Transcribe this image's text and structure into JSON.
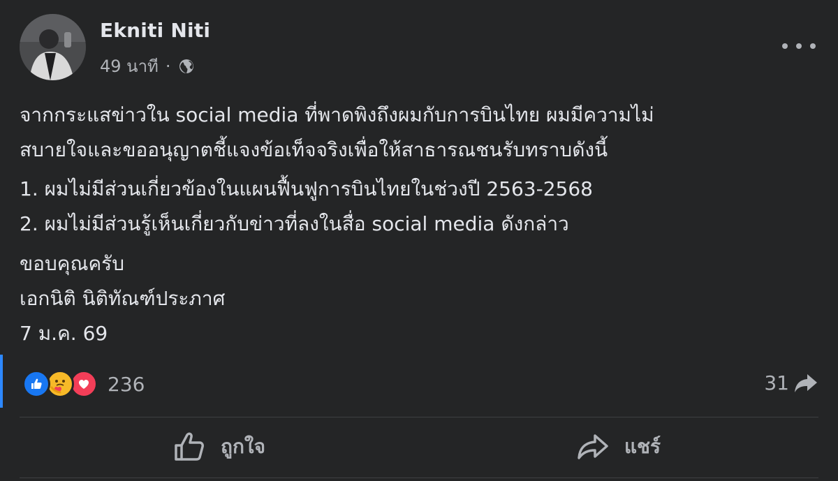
{
  "post": {
    "author": "Ekniti Niti",
    "time": "49 นาที",
    "meta_separator": "·",
    "privacy_icon": "globe-icon",
    "more_icon": "more-horizontal-icon",
    "paragraphs": [
      [
        "จากกระแสข่าวใน social media ที่พาดพิงถึงผมกับการบินไทย ผมมีความไม่",
        "สบายใจและขออนุญาตชี้แจงข้อเท็จจริงเพื่อให้สาธารณชนรับทราบดังนี้"
      ],
      [
        "1. ผมไม่มีส่วนเกี่ยวข้องในแผนฟื้นฟูการบินไทยในช่วงปี 2563-2568",
        "2. ผมไม่มีส่วนรู้เห็นเกี่ยวกับข่าวที่ลงในสื่อ social media ดังกล่าว"
      ],
      [
        "ขอบคุณครับ",
        "เอกนิติ นิติทัณฑ์ประภาศ",
        "7 ม.ค. 69"
      ]
    ]
  },
  "reactions": {
    "types": [
      "like",
      "care",
      "love"
    ],
    "count": "236"
  },
  "shares": {
    "count": "31"
  },
  "actions": {
    "like_label": "ถูกใจ",
    "share_label": "แชร์"
  },
  "colors": {
    "background": "#242526",
    "text_primary": "#e4e6eb",
    "text_secondary": "#b0b3b8",
    "like_blue": "#1877f2",
    "love_red": "#f33e58",
    "care_yellow": "#f7b928",
    "accent_bar": "#2d88ff"
  }
}
